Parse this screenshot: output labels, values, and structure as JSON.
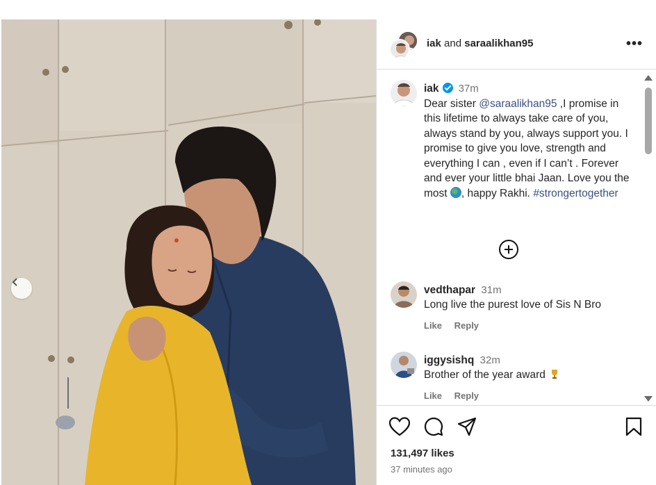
{
  "post": {
    "header": {
      "user1": "iak",
      "joiner": "and",
      "user2": "saraalikhan95",
      "more_label": "•••"
    },
    "caption": {
      "username": "iak",
      "verified": true,
      "time": "37m",
      "text_before": "Dear sister ",
      "mention": "@saraalikhan95",
      "text_middle": " ,I promise in this lifetime to always take care of you, always stand by you, always support you. I promise to give you love, strength and everything I can , even if I can’t . Forever and ever your little bhai Jaan. Love you the most ",
      "emoji_icon": "globe-emoji",
      "text_after": ", happy Rakhi. ",
      "hashtag": "#strongertogether"
    },
    "load_more_icon": "plus-circle-icon",
    "comments": [
      {
        "username": "vedthapar",
        "time": "31m",
        "text": "Long live the purest love of Sis N Bro",
        "like_label": "Like",
        "reply_label": "Reply"
      },
      {
        "username": "iggysishq",
        "time": "32m",
        "text": "Brother of the year award",
        "emoji_icon": "trophy-emoji",
        "like_label": "Like",
        "reply_label": "Reply"
      }
    ],
    "likes": "131,497 likes",
    "posted_ago": "37 minutes ago"
  },
  "colors": {
    "link": "#385185",
    "verified": "#0095f6",
    "muted": "#737373",
    "border": "#dbdbdb"
  }
}
